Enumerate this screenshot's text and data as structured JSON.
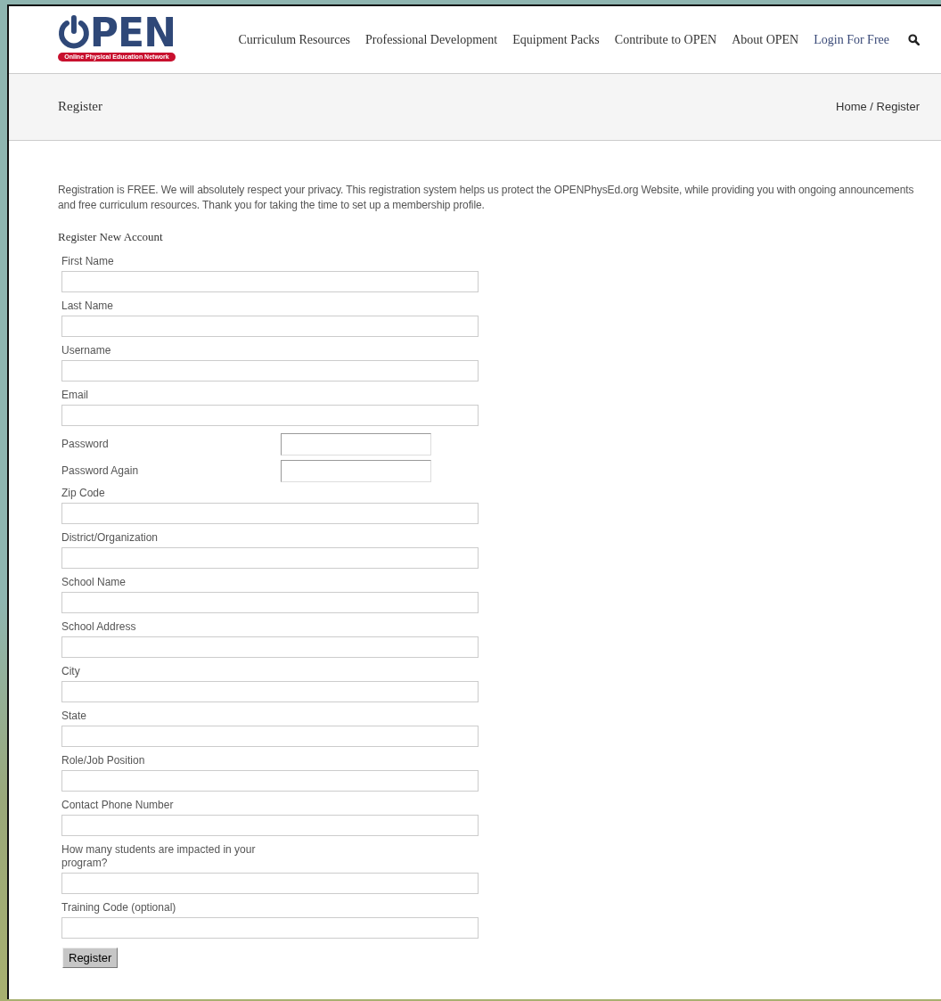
{
  "logo": {
    "mark": "PEN",
    "tagline": "Online Physical Education Network"
  },
  "nav": [
    {
      "label": "Curriculum Resources",
      "kind": "page"
    },
    {
      "label": "Professional Development",
      "kind": "page"
    },
    {
      "label": "Equipment Packs",
      "kind": "page"
    },
    {
      "label": "Contribute to OPEN",
      "kind": "page"
    },
    {
      "label": "About OPEN",
      "kind": "page"
    },
    {
      "label": "Login For Free",
      "kind": "account"
    }
  ],
  "page_title": "Register",
  "breadcrumb": "Home / Register",
  "intro": "Registration is FREE. We will absolutely respect your privacy. This registration system helps us protect the OPENPhysEd.org Website, while providing you with ongoing announcements and free curriculum resources. Thank you for taking the time to set up a membership profile.",
  "form_title": "Register New Account",
  "fields": [
    {
      "label": "First Name",
      "kind": "wide"
    },
    {
      "label": "Last Name",
      "kind": "wide"
    },
    {
      "label": "Username",
      "kind": "wide"
    },
    {
      "label": "Email",
      "kind": "wide"
    },
    {
      "label": "Password",
      "kind": "inline"
    },
    {
      "label": "Password Again",
      "kind": "inline"
    },
    {
      "label": "Zip Code",
      "kind": "wide"
    },
    {
      "label": "District/Organization",
      "kind": "wide"
    },
    {
      "label": "School Name",
      "kind": "wide"
    },
    {
      "label": "School Address",
      "kind": "wide"
    },
    {
      "label": "City",
      "kind": "wide"
    },
    {
      "label": "State",
      "kind": "wide"
    },
    {
      "label": "Role/Job Position",
      "kind": "wide"
    },
    {
      "label": "Contact Phone Number",
      "kind": "wide"
    },
    {
      "label": "How many students are impacted in your program?",
      "kind": "wide"
    },
    {
      "label": "Training Code (optional)",
      "kind": "wide"
    }
  ],
  "submit": "Register"
}
